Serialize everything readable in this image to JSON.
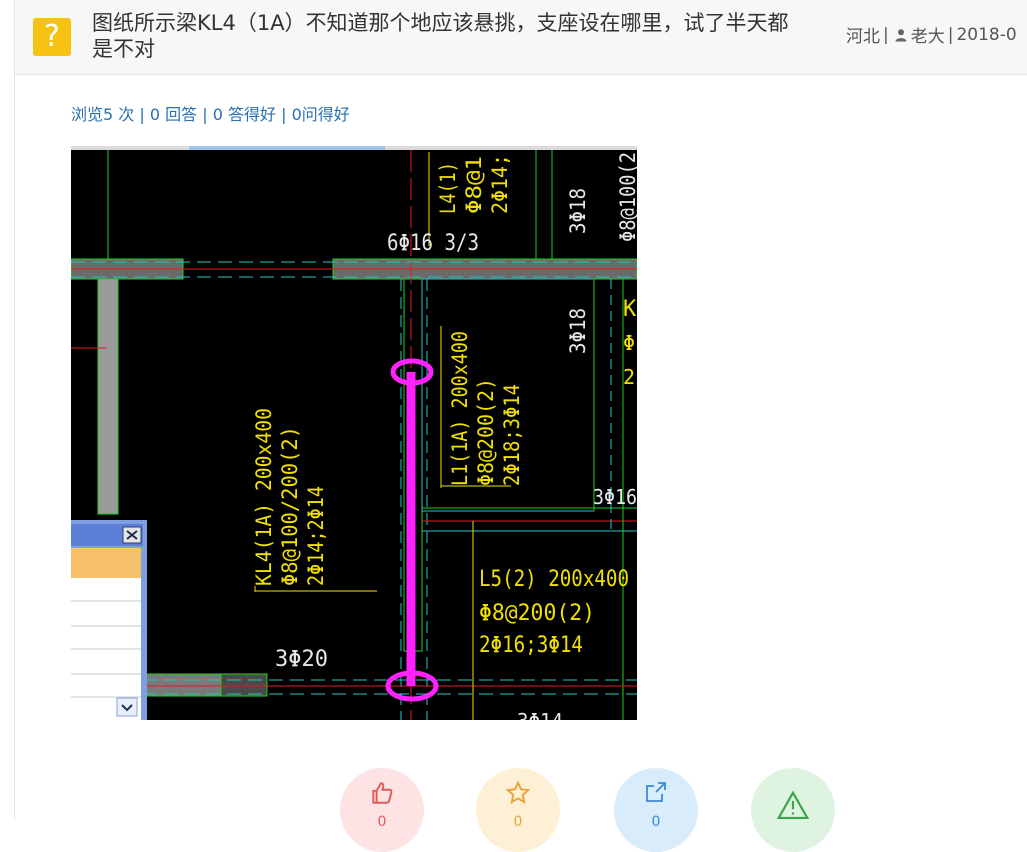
{
  "header": {
    "badge_icon": "question-mark-icon",
    "badge_glyph": "?",
    "title": "图纸所示梁KL4（1A）不知道那个地应该悬挑，支座设在哪里，试了半天都是不对",
    "meta": {
      "region": "河北",
      "separator": "|",
      "user_icon": "user-icon",
      "user": "老大",
      "date": "2018-0"
    }
  },
  "stats": {
    "views": "浏览5 次",
    "answers": "0 回答",
    "good_answers": "0 答得好",
    "good_questions": "0问得好",
    "separator": "|"
  },
  "cad": {
    "label_top": "6Φ16 3/3",
    "kl4": [
      "KL4(1A) 200x400",
      "Φ8@100/200(2)",
      "2Φ14;2Φ14"
    ],
    "l1": [
      "L1(1A) 200x400",
      "Φ8@200(2)",
      "2Φ18;3Φ14"
    ],
    "l4": [
      "L4(1)",
      "Φ8@1",
      "2Φ14;"
    ],
    "l5": [
      "L5(2) 200x400",
      "Φ8@200(2)",
      "2Φ16;3Φ14"
    ],
    "bar_3_18_top": "3Φ18",
    "bar_3_18_mid": "3Φ18",
    "bar_3_20": "3Φ20",
    "bar_3_16": "3Φ16",
    "bar_3_14": "3Φ14",
    "cut_right_top": "Φ8@100(2",
    "cut_k": "K",
    "cut_phi": "Φ",
    "cut_2": "2",
    "highlight_color": "#ff22ff"
  },
  "actions": [
    {
      "name": "like-button",
      "icon": "thumbs-up-icon",
      "bg": "#fde3e3",
      "fg": "#e05a5a",
      "count": "0"
    },
    {
      "name": "favorite-button",
      "icon": "star-icon",
      "bg": "#fdf0d5",
      "fg": "#e9a33b",
      "count": "0"
    },
    {
      "name": "share-button",
      "icon": "share-icon",
      "bg": "#d9ecfb",
      "fg": "#3a8ad6",
      "count": "0"
    },
    {
      "name": "report-button",
      "icon": "warning-icon",
      "bg": "#dff3e1",
      "fg": "#3aa54a",
      "count": ""
    }
  ]
}
